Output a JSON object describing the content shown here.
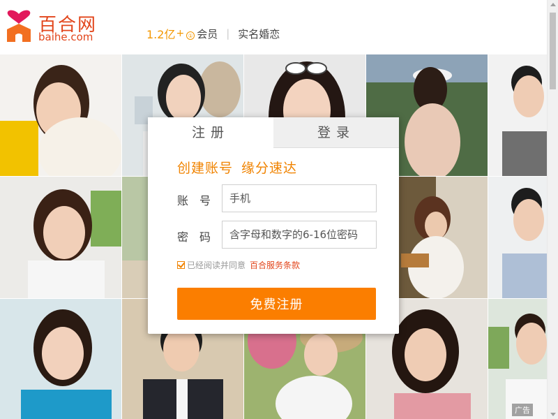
{
  "brand": {
    "name_cn": "百合网",
    "name_en": "baihe.com",
    "color": "#e2451b"
  },
  "header": {
    "member_count": "1.2亿",
    "member_plus": "+",
    "info_badge": "①",
    "member_label": "会员",
    "separator": "|",
    "verified_label": "实名婚恋"
  },
  "form": {
    "tabs": [
      {
        "label": "注册",
        "active": true
      },
      {
        "label": "登录",
        "active": false
      }
    ],
    "slogan_part1": "创建账号",
    "slogan_part2": "缘分速达",
    "account_label": "账号",
    "account_placeholder": "手机",
    "password_label": "密码",
    "password_placeholder": "含字母和数字的6-16位密码",
    "agree_checked": true,
    "agree_text": "已经阅读并同意",
    "agree_link": "百合服务条款",
    "submit_label": "免费注册"
  },
  "ad_tag": "广告",
  "colors": {
    "accent": "#fb7e00",
    "slogan": "#f08300",
    "stat": "#f39700"
  },
  "icons": {
    "logo": "heart-house-logo-icon",
    "checkbox": "check-icon",
    "scroll_up": "scroll-up-arrow-icon",
    "scroll_down": "scroll-down-arrow-icon"
  }
}
